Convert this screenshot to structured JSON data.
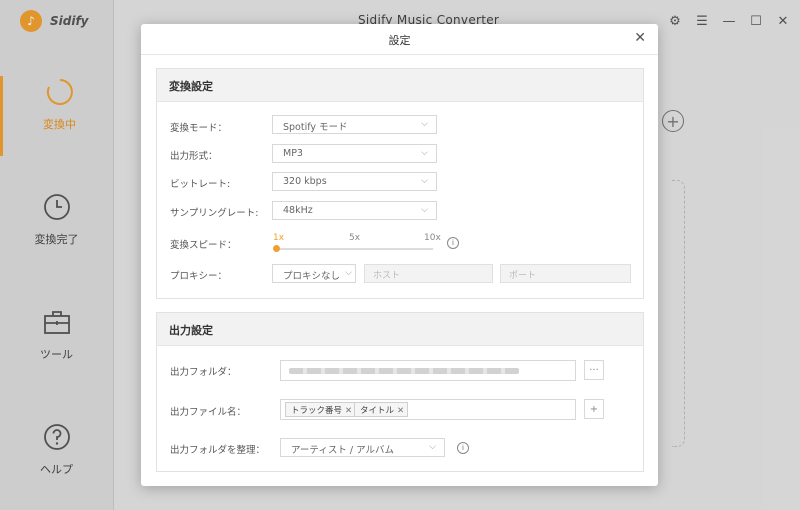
{
  "app": {
    "brand": "Sidify",
    "window_title": "Sidify Music Converter",
    "nav": [
      {
        "label": "変換中",
        "icon": "converting-icon"
      },
      {
        "label": "変換完了",
        "icon": "clock-icon"
      },
      {
        "label": "ツール",
        "icon": "toolbox-icon"
      },
      {
        "label": "ヘルプ",
        "icon": "help-icon"
      }
    ],
    "accent": "#f0a030"
  },
  "dialog": {
    "title": "設定",
    "convert_section": {
      "title": "変換設定",
      "mode": {
        "label": "変換モード：",
        "value": "Spotify モード"
      },
      "format": {
        "label": "出力形式：",
        "value": "MP3"
      },
      "bitrate": {
        "label": "ビットレート:",
        "value": "320 kbps"
      },
      "samplerate": {
        "label": "サンプリングレート:",
        "value": "48kHz"
      },
      "speed": {
        "label": "変換スピード：",
        "ticks": [
          "1x",
          "5x",
          "10x"
        ],
        "value_fraction": 0
      }
    },
    "proxy": {
      "label": "プロキシー：",
      "value": "プロキシなし",
      "host_placeholder": "ホスト",
      "port_placeholder": "ポート"
    },
    "output_section": {
      "title": "出力設定",
      "folder": {
        "label": "出力フォルダ：",
        "browse_label": "···"
      },
      "filename": {
        "label": "出力ファイル名：",
        "tags": [
          "トラック番号",
          "タイトル"
        ],
        "add_label": "+"
      },
      "organize": {
        "label": "出力フォルダを整理：",
        "value": "アーティスト / アルバム"
      }
    }
  }
}
